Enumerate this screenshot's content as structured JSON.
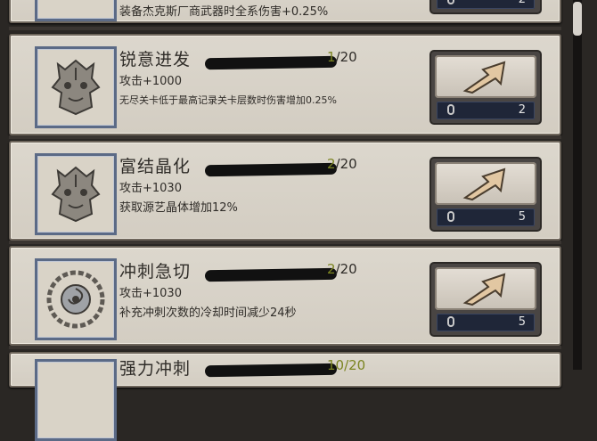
{
  "top_partial": {
    "effect": "装备杰克斯厂商武器时全系伤害+0.25%",
    "cost": "2"
  },
  "skills": [
    {
      "title": "锐意进发",
      "level_current": "1",
      "level_sep_max": "/20",
      "attack": "攻击+1000",
      "effect": "无尽关卡低于最高记录关卡层数时伤害增加0.25%",
      "cost": "2",
      "icon": "beast-mask-icon"
    },
    {
      "title": "富结晶化",
      "level_current": "2",
      "level_sep_max": "/20",
      "attack": "攻击+1030",
      "effect": "获取源艺晶体增加12%",
      "cost": "5",
      "icon": "beast-mask-icon"
    },
    {
      "title": "冲刺急切",
      "level_current": "2",
      "level_sep_max": "/20",
      "attack": "攻击+1030",
      "effect": "补充冲刺次数的冷却时间减少24秒",
      "cost": "5",
      "icon": "swirl-wreath-icon"
    }
  ],
  "bottom_partial": {
    "title": "强力冲刺",
    "level": "10/20"
  },
  "colors": {
    "card_bg": "#d6d0c5",
    "frame_blue": "#5b6a86",
    "arrow_tan": "#e2c7a2",
    "level_green": "#7b8421"
  }
}
